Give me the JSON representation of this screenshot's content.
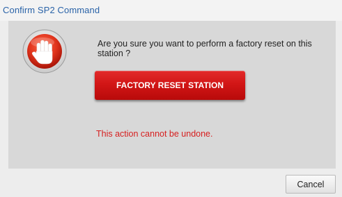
{
  "window": {
    "title": "Confirm SP2 Command"
  },
  "dialog": {
    "icon": "stop-hand-icon",
    "message": "Are you sure you want to perform a factory reset on this station ?",
    "primary_action_label": "FACTORY RESET STATION",
    "warning_text": "This action cannot be undone.",
    "cancel_label": "Cancel"
  },
  "colors": {
    "title_text": "#2a63a8",
    "primary_button": "#d21616",
    "warning_text": "#d61e1e",
    "content_background": "#d8d8d8"
  }
}
